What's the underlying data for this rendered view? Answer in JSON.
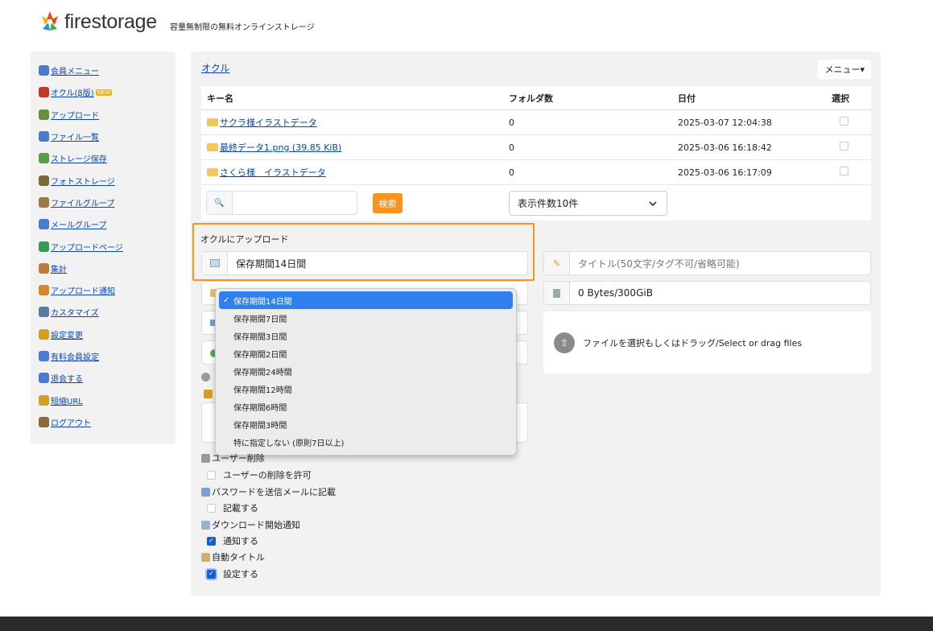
{
  "header": {
    "brand": "firestorage",
    "tagline": "容量無制限の無料オンラインストレージ"
  },
  "sidebar": {
    "items": [
      {
        "label": "会員メニュー",
        "icon": "user-icon",
        "color": "#4a7bd0"
      },
      {
        "label": "オクル(β版)",
        "icon": "user-red-icon",
        "color": "#c0392b",
        "badge": "NEW"
      },
      {
        "label": "アップロード",
        "icon": "upload-icon",
        "color": "#6a8f3a"
      },
      {
        "label": "ファイル一覧",
        "icon": "list-icon",
        "color": "#4a7bd0"
      },
      {
        "label": "ストレージ保存",
        "icon": "storage-icon",
        "color": "#5a9c4a"
      },
      {
        "label": "フォトストレージ",
        "icon": "photo-icon",
        "color": "#7a6a3a"
      },
      {
        "label": "ファイルグループ",
        "icon": "group-icon",
        "color": "#9a7a4a"
      },
      {
        "label": "メールグループ",
        "icon": "mail-icon",
        "color": "#4a7bd0"
      },
      {
        "label": "アップロードページ",
        "icon": "globe-icon",
        "color": "#3a9a5a"
      },
      {
        "label": "集計",
        "icon": "chart-icon",
        "color": "#c07a3a"
      },
      {
        "label": "アップロード通知",
        "icon": "bell-icon",
        "color": "#d08a2a"
      },
      {
        "label": "カスタマイズ",
        "icon": "wrench-icon",
        "color": "#5a7aa0"
      },
      {
        "label": "設定変更",
        "icon": "key-icon",
        "color": "#d0a020"
      },
      {
        "label": "有料会員設定",
        "icon": "user-icon",
        "color": "#4a7bd0"
      },
      {
        "label": "退会する",
        "icon": "user-icon",
        "color": "#4a7bd0"
      },
      {
        "label": "短縮URL",
        "icon": "link-icon",
        "color": "#d0a020"
      },
      {
        "label": "ログアウト",
        "icon": "logout-icon",
        "color": "#8a6a3a"
      }
    ]
  },
  "main": {
    "breadcrumb": "オクル",
    "menu_label": "メニュー▾",
    "table": {
      "headers": [
        "キー名",
        "フォルダ数",
        "日付",
        "選択"
      ],
      "rows": [
        {
          "name": "サクラ様イラストデータ",
          "count": "0",
          "date": "2025-03-07 12:04:38"
        },
        {
          "name": "最終データ1.png (39.85 KiB)",
          "count": "0",
          "date": "2025-03-06 16:18:42"
        },
        {
          "name": "さくら様　イラストデータ",
          "count": "0",
          "date": "2025-03-06 16:17:09"
        }
      ]
    },
    "search": {
      "button_label": "検索",
      "count_select": "表示件数10件"
    },
    "upload": {
      "section_label": "オクルにアップロード",
      "retention_value": "保存期間14日間",
      "title_placeholder": "タイトル(50文字/タグ不可/省略可能)",
      "capacity": "0 Bytes/300GiB",
      "drop_text": "ファイルを選択もしくはドラッグ/Select or drag files"
    },
    "retention_options": [
      "保存期間14日間",
      "保存期間7日間",
      "保存期間3日間",
      "保存期間2日間",
      "保存期間24時間",
      "保存期間12時間",
      "保存期間6時間",
      "保存期間3時間",
      "特に指定しない (原則7日以上)"
    ],
    "options": {
      "user_delete_title": "ユーザー削除",
      "user_delete_label": "ユーザーの削除を許可",
      "password_title": "パスワードを送信メールに記載",
      "password_label": "記載する",
      "download_notify_title": "ダウンロード開始通知",
      "download_notify_label": "通知する",
      "auto_title_title": "自動タイトル",
      "auto_title_label": "設定する"
    }
  },
  "colors": {
    "accent": "#f7931e",
    "selected": "#2f80ed",
    "link": "#0645ad"
  }
}
